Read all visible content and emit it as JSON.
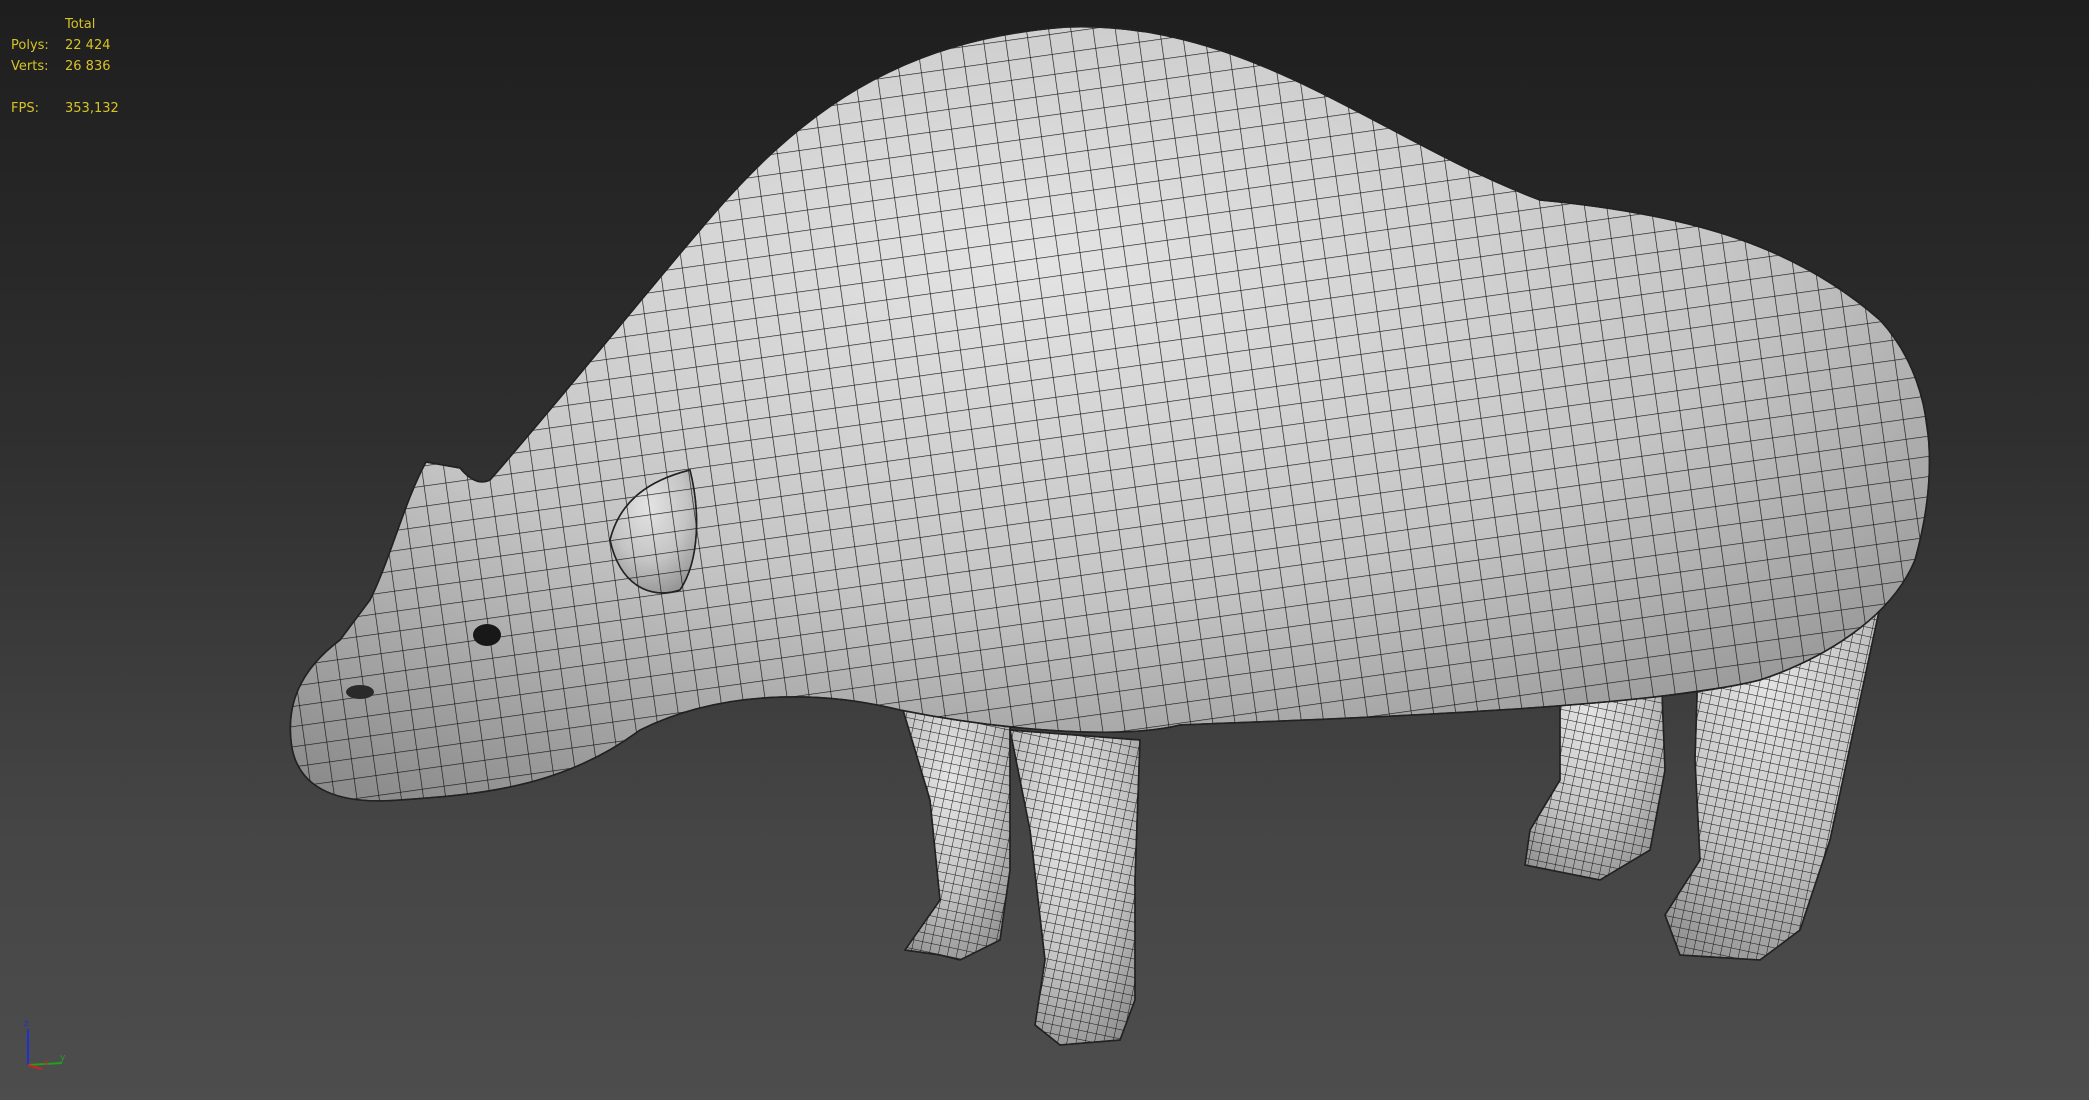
{
  "stats": {
    "header": "Total",
    "polys_label": "Polys:",
    "polys_value": "22 424",
    "verts_label": "Verts:",
    "verts_value": "26 836",
    "fps_label": "FPS:",
    "fps_value": "353,132"
  },
  "axis_gizmo": {
    "x": "x",
    "y": "y",
    "z": "z",
    "x_color": "#d02020",
    "y_color": "#20a020",
    "z_color": "#2030d0"
  },
  "colors": {
    "stats_text": "#d6c326",
    "wire": "#141414"
  }
}
